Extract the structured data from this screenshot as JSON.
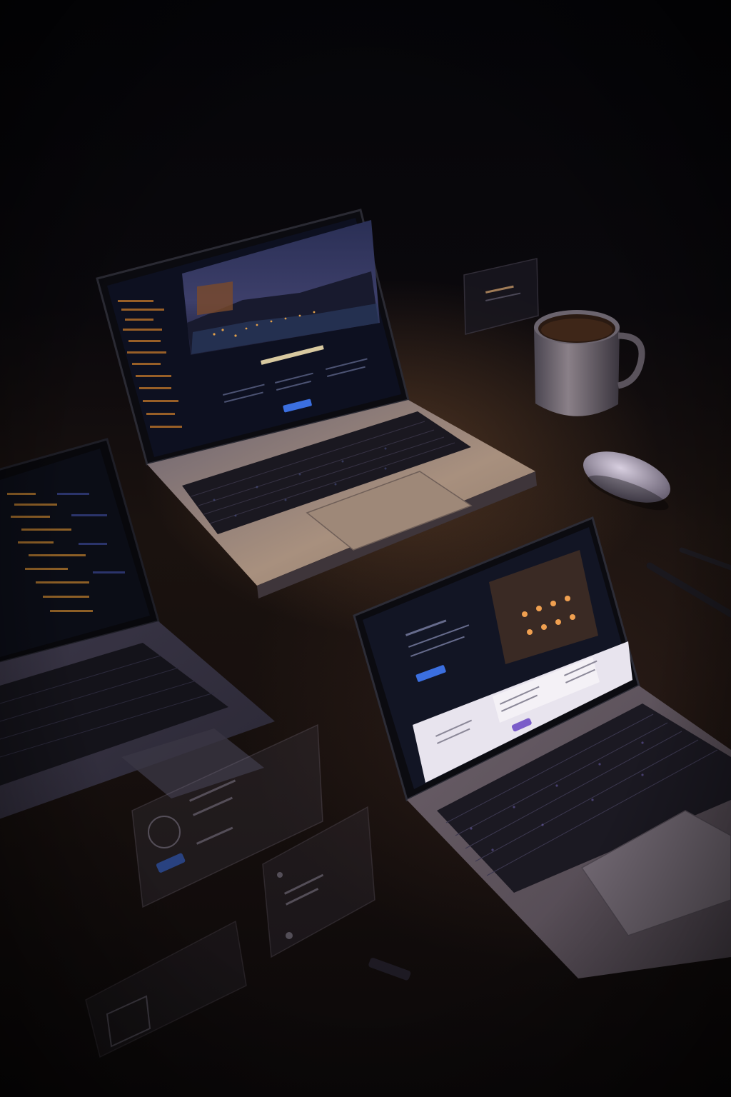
{
  "scene": {
    "description_tags": [
      "laptop-top",
      "laptop-left",
      "laptop-right",
      "coffee-mug",
      "mouse",
      "pens",
      "floating-ui-cards"
    ],
    "colors": {
      "background": "#07060a",
      "desk": "#1a120f",
      "accent_blue": "#3b6fe0",
      "accent_purple": "#7a5cc9",
      "code_orange": "#d9822b",
      "warm_light": "#c89a6a"
    }
  }
}
